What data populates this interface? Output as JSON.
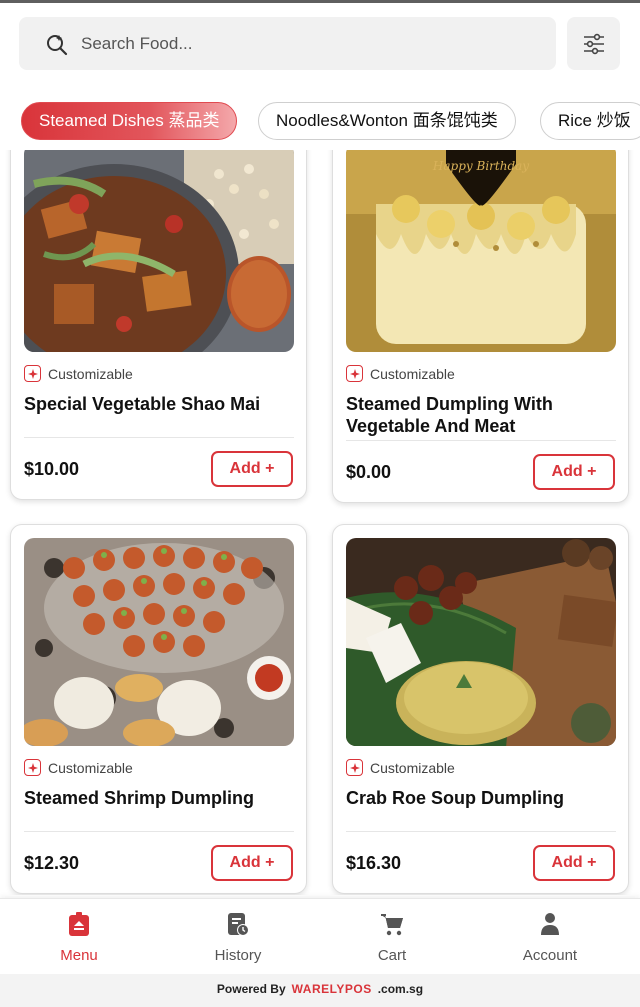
{
  "search": {
    "placeholder": "Search Food..."
  },
  "categories": [
    {
      "label": "Steamed Dishes 蒸品类",
      "active": true
    },
    {
      "label": "Noodles&Wonton 面条馄饨类",
      "active": false
    },
    {
      "label": "Rice 炒饭",
      "active": false
    }
  ],
  "products": [
    {
      "tag": "Customizable",
      "name": "Special Vegetable Shao Mai",
      "price": "$10.00",
      "add_label": "Add +"
    },
    {
      "tag": "Customizable",
      "name": "Steamed Dumpling With Vegetable And Meat",
      "price": "$0.00",
      "add_label": "Add +"
    },
    {
      "tag": "Customizable",
      "name": "Steamed Shrimp Dumpling",
      "price": "$12.30",
      "add_label": "Add +"
    },
    {
      "tag": "Customizable",
      "name": "Crab Roe Soup Dumpling",
      "price": "$16.30",
      "add_label": "Add +"
    }
  ],
  "cake_topper_text": "Happy Birthday",
  "nav": [
    {
      "label": "Menu",
      "icon": "menu-icon",
      "active": true
    },
    {
      "label": "History",
      "icon": "history-icon",
      "active": false
    },
    {
      "label": "Cart",
      "icon": "cart-icon",
      "active": false
    },
    {
      "label": "Account",
      "icon": "account-icon",
      "active": false
    }
  ],
  "footer": {
    "powered_by": "Powered By",
    "brand": "WARELYPOS",
    "domain": ".com.sg"
  },
  "colors": {
    "accent": "#d9343a",
    "muted_bg": "#f1f1f1"
  }
}
